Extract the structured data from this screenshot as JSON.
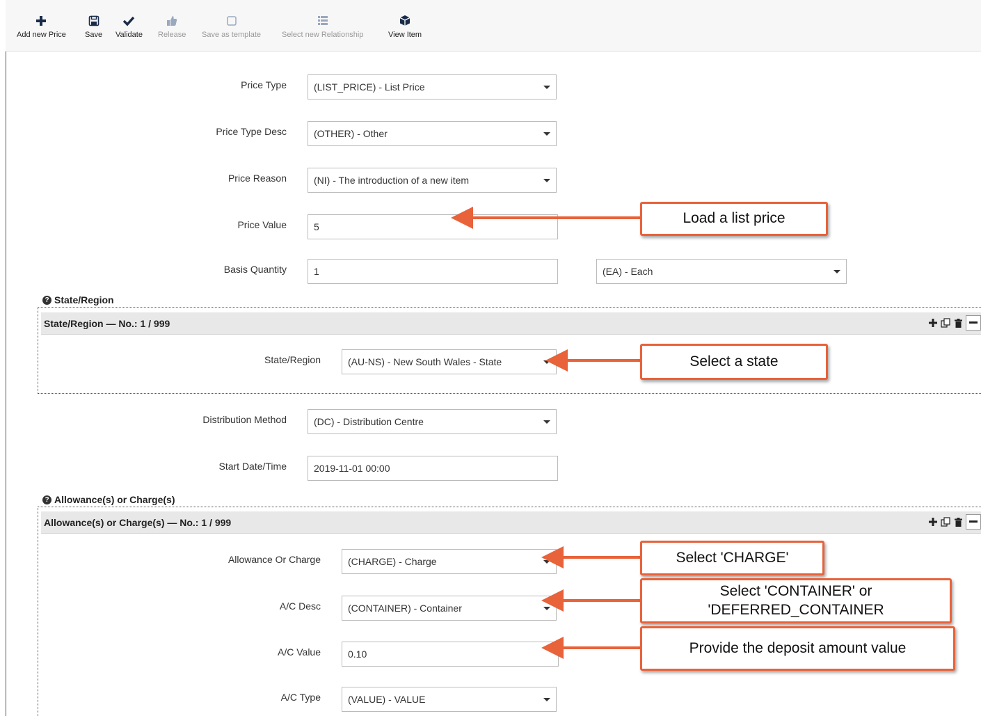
{
  "toolbar": {
    "add_new_price": "Add new Price",
    "save": "Save",
    "validate": "Validate",
    "release": "Release",
    "save_as_template": "Save as template",
    "select_new_relationship": "Select new Relationship",
    "view_item": "View Item"
  },
  "form": {
    "price_type": {
      "label": "Price Type",
      "value": "(LIST_PRICE) - List Price"
    },
    "price_type_desc": {
      "label": "Price Type Desc",
      "value": "(OTHER) - Other"
    },
    "price_reason": {
      "label": "Price Reason",
      "value": "(NI) - The introduction of a new item"
    },
    "price_value": {
      "label": "Price Value",
      "value": "5"
    },
    "basis_quantity": {
      "label": "Basis Quantity",
      "value": "1",
      "unit": "(EA) - Each"
    },
    "distribution_method": {
      "label": "Distribution Method",
      "value": "(DC) - Distribution Centre"
    },
    "start_datetime": {
      "label": "Start Date/Time",
      "value": "2019-11-01 00:00"
    }
  },
  "state_region": {
    "heading": "State/Region",
    "bar_title": "State/Region — No.: 1 / 999",
    "field": {
      "label": "State/Region",
      "value": "(AU-NS) - New South Wales - State"
    }
  },
  "allowance": {
    "heading": "Allowance(s) or Charge(s)",
    "bar_title": "Allowance(s) or Charge(s) — No.: 1 / 999",
    "allowance_or_charge": {
      "label": "Allowance Or Charge",
      "value": "(CHARGE) - Charge"
    },
    "ac_desc": {
      "label": "A/C Desc",
      "value": "(CONTAINER) - Container"
    },
    "ac_value": {
      "label": "A/C Value",
      "value": "0.10"
    },
    "ac_type": {
      "label": "A/C Type",
      "value": "(VALUE) - VALUE"
    }
  },
  "callouts": {
    "load_list_price": "Load a list price",
    "select_state": "Select a state",
    "select_charge": "Select 'CHARGE'",
    "select_container_1": "Select 'CONTAINER' or",
    "select_container_2": "'DEFERRED_CONTAINER",
    "deposit_value": "Provide the deposit amount value"
  },
  "colors": {
    "callout_border": "#e8623a",
    "arrow": "#e8623a",
    "section_bar": "#e8e8e8"
  }
}
